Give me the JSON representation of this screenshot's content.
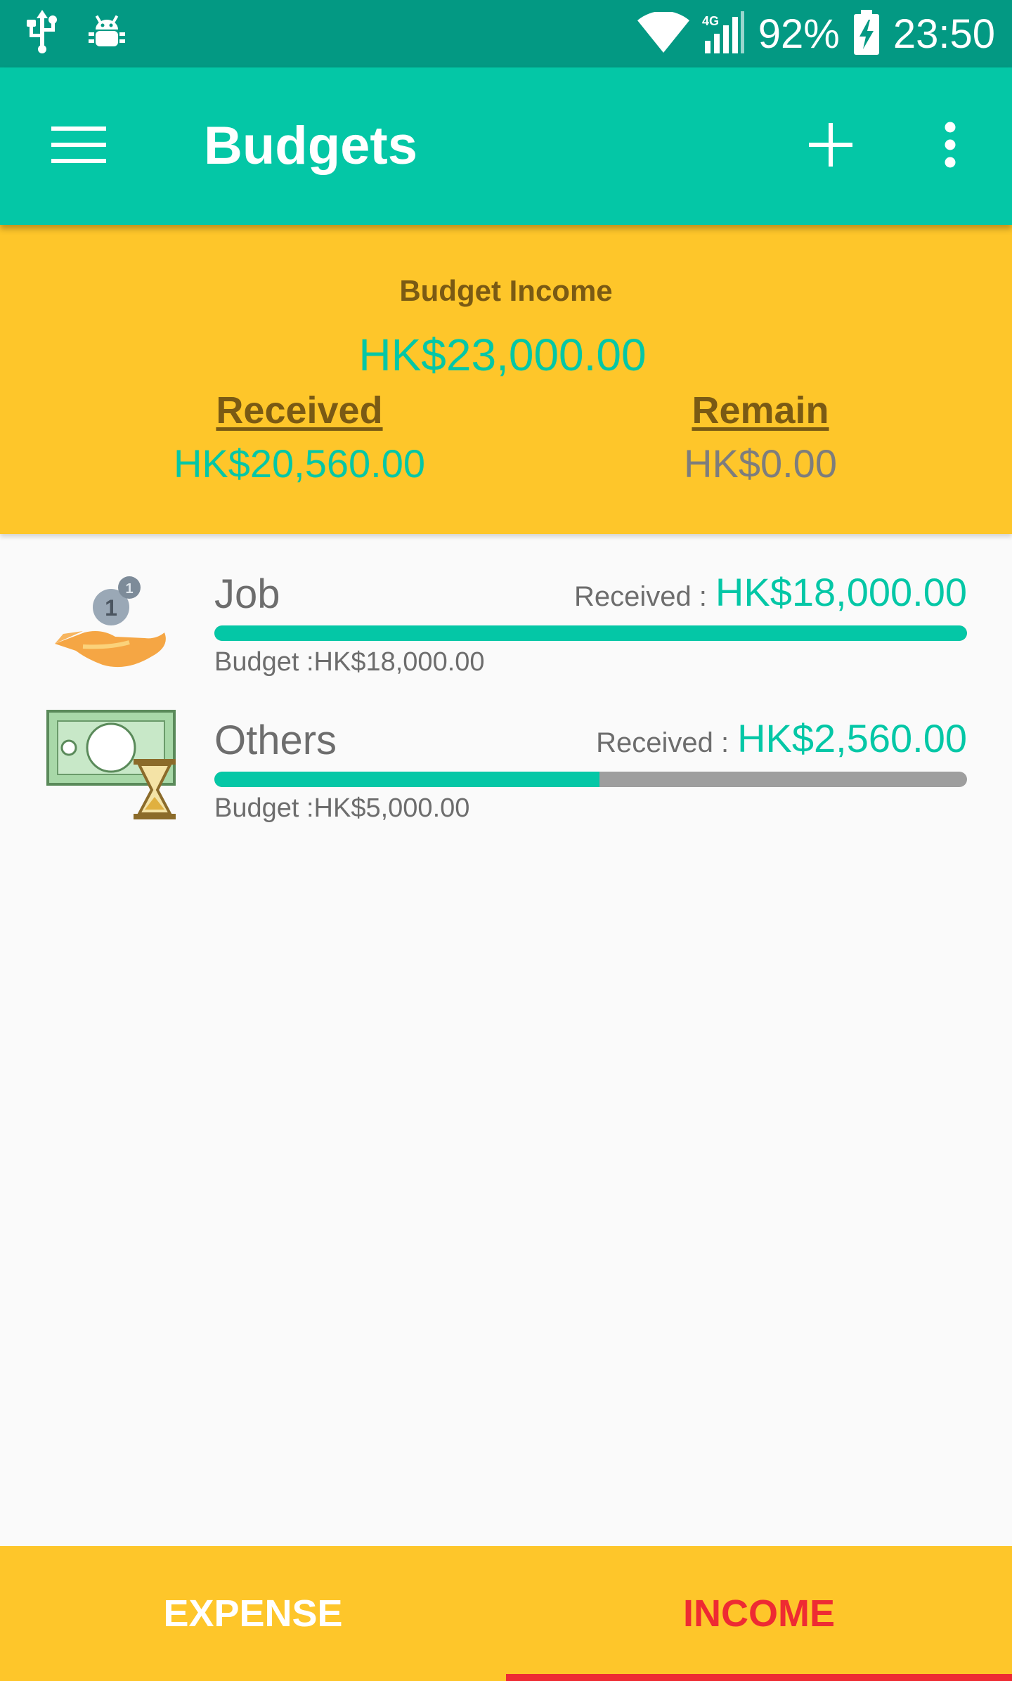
{
  "status_bar": {
    "battery": "92%",
    "time": "23:50",
    "network": "4G",
    "icons": [
      "usb-icon",
      "android-debug-icon",
      "wifi-icon",
      "signal-icon",
      "battery-charging-icon"
    ]
  },
  "app_bar": {
    "title": "Budgets",
    "icons": [
      "menu-icon",
      "add-icon",
      "more-vert-icon"
    ]
  },
  "summary": {
    "title": "Budget Income",
    "total": "HK$23,000.00",
    "received_label": "Received",
    "received_value": "HK$20,560.00",
    "remain_label": "Remain",
    "remain_value": "HK$0.00"
  },
  "items": [
    {
      "name": "Job",
      "icon": "hand-coins-icon",
      "received_label": "Received :",
      "received_value": "HK$18,000.00",
      "budget_text": "Budget :HK$18,000.00",
      "progress": 1.0
    },
    {
      "name": "Others",
      "icon": "cash-hourglass-icon",
      "received_label": "Received :",
      "received_value": "HK$2,560.00",
      "budget_text": "Budget :HK$5,000.00",
      "progress": 0.512
    }
  ],
  "tabs": [
    {
      "label": "EXPENSE",
      "selected": false
    },
    {
      "label": "INCOME",
      "selected": true
    }
  ],
  "colors": {
    "accent": "#04c7a6",
    "status_bar": "#039983",
    "summary_bg": "#fec62a",
    "selected_tab": "#ee2b33"
  }
}
